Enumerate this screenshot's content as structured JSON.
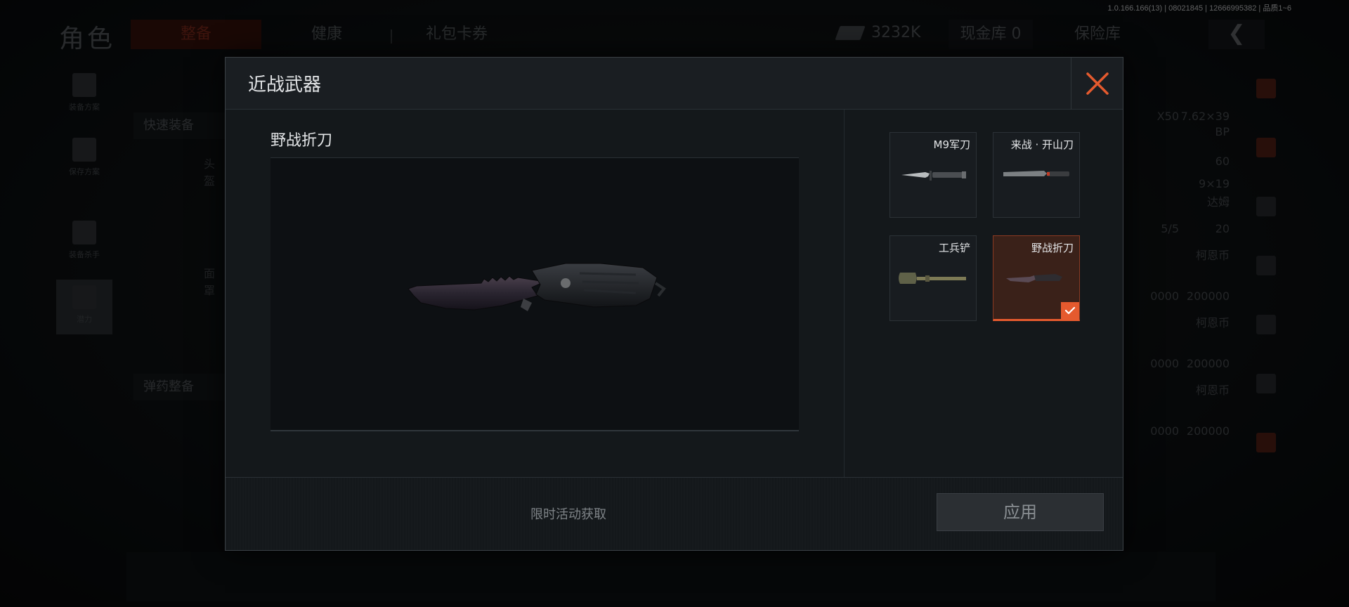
{
  "version": "1.0.166.166(13) | 08021845 | 12666995382 | 品质1~6",
  "background": {
    "title": "角色",
    "tabs": [
      "整备",
      "健康",
      "礼包卡券"
    ],
    "money": "3232K",
    "cash_vault": "现金库 0",
    "safe_vault": "保险库",
    "left_nav": [
      "装备方案",
      "保存方案",
      "装备杀手",
      "潜力"
    ],
    "left_buttons": [
      "快速装备",
      "弹药整备"
    ],
    "left_labels": [
      "头盔",
      "面罩"
    ],
    "grid": [
      "X50",
      "7.62×39",
      "BP",
      "60",
      "9×19",
      "达姆",
      "20",
      "5/5",
      "柯恩币",
      "200000",
      "柯恩币",
      "200000",
      "柯恩币",
      "200000",
      "0000",
      "0000",
      "0000"
    ]
  },
  "modal": {
    "title": "近战武器",
    "weapon_name": "野战折刀",
    "weapons": [
      {
        "label": "M9军刀",
        "icon": "bayonet-icon"
      },
      {
        "label": "来战 · 开山刀",
        "icon": "machete-icon"
      },
      {
        "label": "工兵铲",
        "icon": "shovel-icon"
      },
      {
        "label": "野战折刀",
        "icon": "folding-knife-icon",
        "selected": true
      }
    ],
    "footer_note": "限时活动获取",
    "apply_label": "应用"
  },
  "colors": {
    "accent": "#e55a2e",
    "panel": "#14181b",
    "selected_card": "#3a2119"
  }
}
